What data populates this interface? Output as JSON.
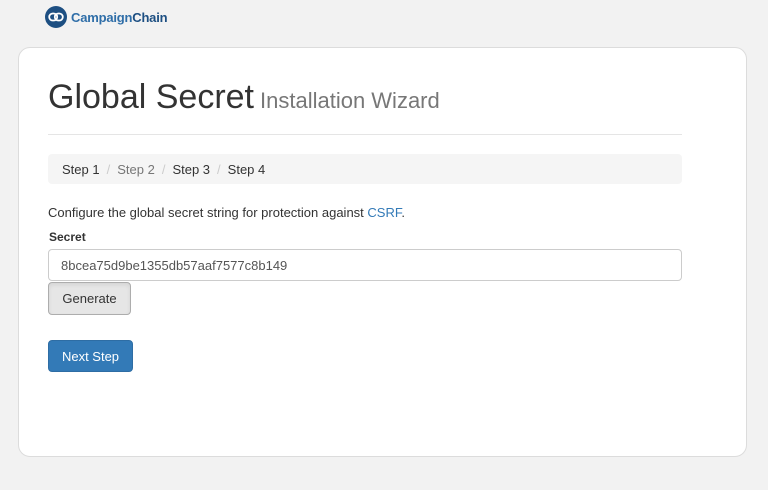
{
  "brand": {
    "logo_icon": "link-chain-icon",
    "name_part1": "Campaign",
    "name_part2": "Chain",
    "color_primary": "#2f6ea8",
    "color_dark": "#1d4f82"
  },
  "header": {
    "title": "Global Secret",
    "subtitle": "Installation Wizard"
  },
  "breadcrumb": {
    "steps": [
      {
        "label": "Step 1",
        "state": "done"
      },
      {
        "label": "Step 2",
        "state": "muted"
      },
      {
        "label": "Step 3",
        "state": "done"
      },
      {
        "label": "Step 4",
        "state": "current"
      }
    ],
    "separator": "/"
  },
  "intro": {
    "text": "Configure the global secret string for protection against ",
    "link_text": "CSRF",
    "suffix": "."
  },
  "form": {
    "secret_label": "Secret",
    "secret_value": "8bcea75d9be1355db57aaf7577c8b149",
    "generate_label": "Generate",
    "next_label": "Next Step"
  },
  "colors": {
    "accent": "#337ab7",
    "page_background": "#f2f2f2"
  }
}
